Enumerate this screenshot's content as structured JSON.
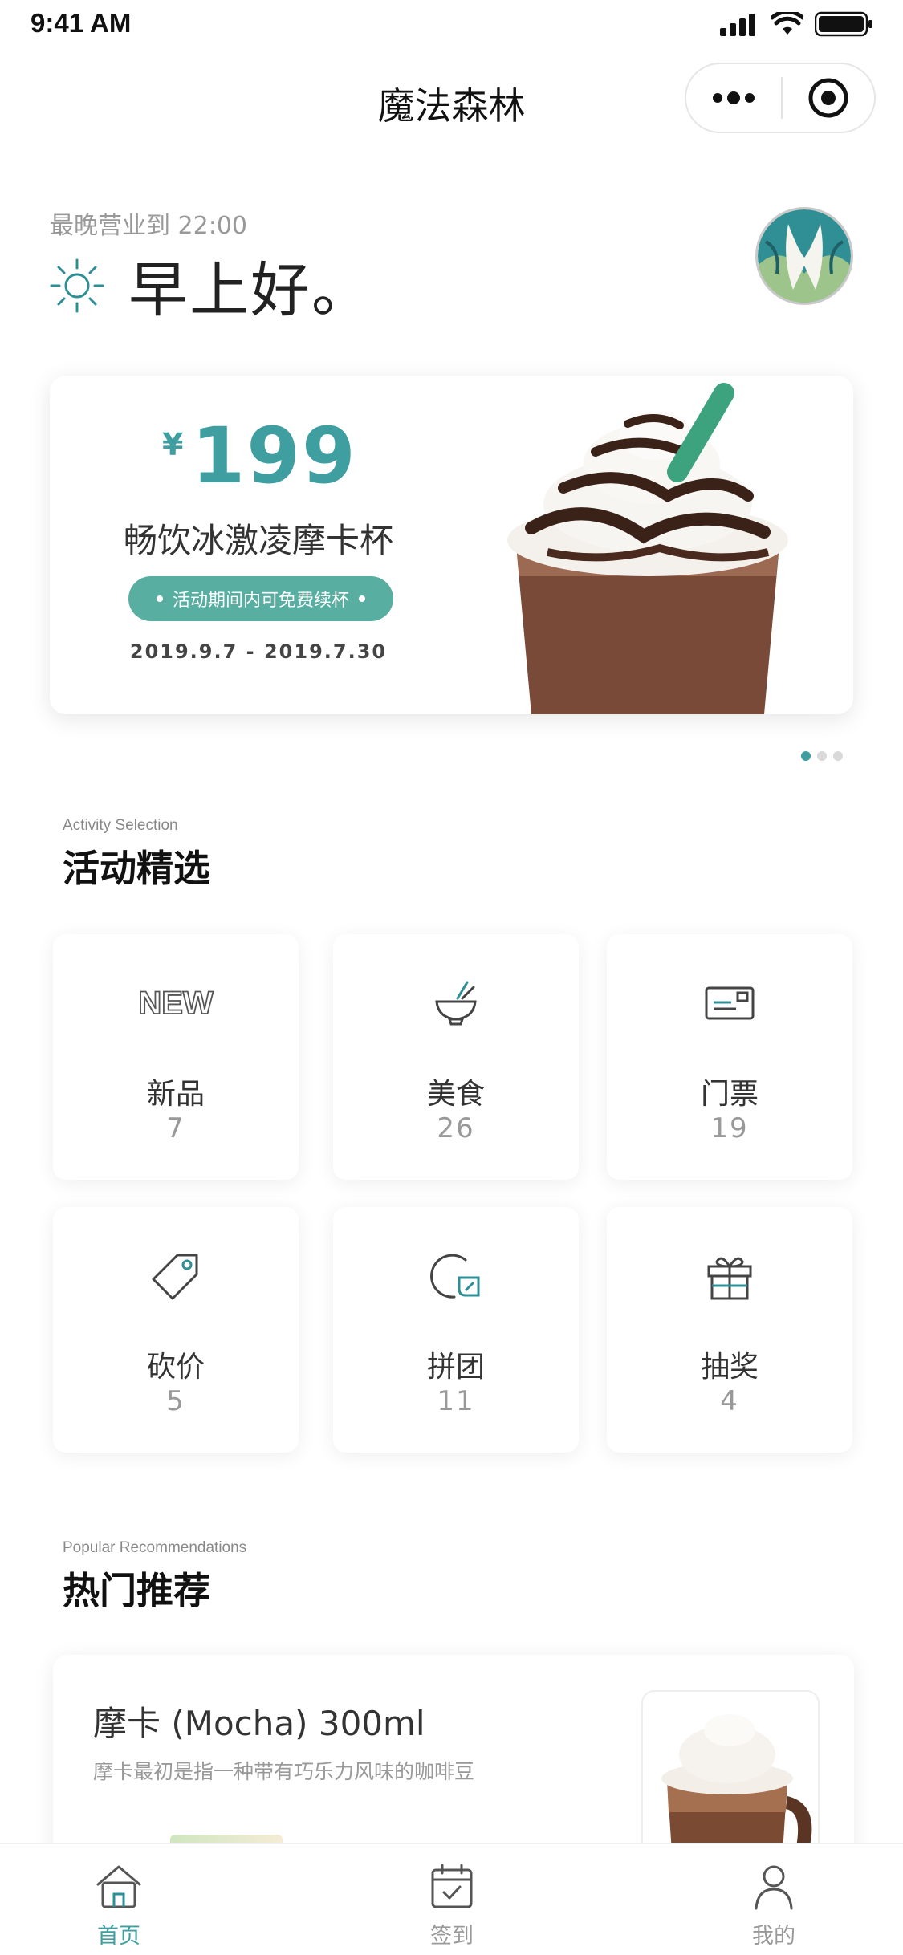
{
  "status": {
    "time": "9:41 AM"
  },
  "nav": {
    "title": "魔法森林"
  },
  "greeting": {
    "hours": "最晚营业到 22:00",
    "text": "早上好。"
  },
  "banner": {
    "currency": "¥",
    "price": "199",
    "title": "畅饮冰激凌摩卡杯",
    "tag": "活动期间内可免费续杯",
    "dates": "2019.9.7 - 2019.7.30",
    "pager": {
      "count": 3,
      "active": 1
    }
  },
  "activity": {
    "subtitle": "Activity Selection",
    "title": "活动精选",
    "items": [
      {
        "label": "新品",
        "count": "7",
        "icon": "new-badge-icon"
      },
      {
        "label": "美食",
        "count": "26",
        "icon": "food-bowl-icon"
      },
      {
        "label": "门票",
        "count": "19",
        "icon": "ticket-icon"
      },
      {
        "label": "砍价",
        "count": "5",
        "icon": "price-tag-icon"
      },
      {
        "label": "拼团",
        "count": "11",
        "icon": "group-buy-icon"
      },
      {
        "label": "抽奖",
        "count": "4",
        "icon": "gift-icon"
      }
    ]
  },
  "popular": {
    "subtitle": "Popular Recommendations",
    "title": "热门推荐",
    "product": {
      "name": "摩卡 (Mocha) 300ml",
      "desc": "摩卡最初是指一种带有巧乐力风味的咖啡豆"
    }
  },
  "tabs": [
    {
      "label": "首页",
      "icon": "home-icon",
      "active": true
    },
    {
      "label": "签到",
      "icon": "calendar-check-icon",
      "active": false
    },
    {
      "label": "我的",
      "icon": "user-icon",
      "active": false
    }
  ],
  "colors": {
    "accent": "#3e9ea0",
    "pill": "#58aea0",
    "muted": "#999999"
  }
}
